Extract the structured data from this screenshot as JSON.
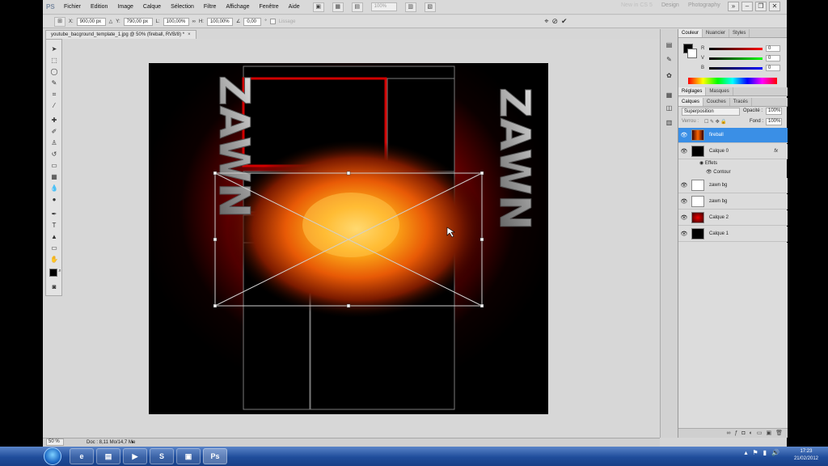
{
  "app": {
    "logo": "PS",
    "menus": [
      "Fichier",
      "Edition",
      "Image",
      "Calque",
      "Sélection",
      "Filtre",
      "Affichage",
      "Fenêtre",
      "Aide"
    ],
    "zoom_display": "100%",
    "workspaces": [
      "New in CS 5",
      "Design",
      "Photography"
    ],
    "overflow": "»"
  },
  "options_bar": {
    "x_label": "X:",
    "x_value": "900,00 px",
    "y_label": "Y:",
    "y_value": "790,00 px",
    "w_label": "L:",
    "w_value": "100,00%",
    "h_label": "H:",
    "h_value": "100,00%",
    "angle_value": "0,00",
    "lissage_label": "Lissage"
  },
  "document": {
    "tab_title": "youtube_bacground_template_1.jpg @ 50% (fireball, RVB/8) *",
    "zoom": "50 %",
    "doc_info": "Doc : 8,11 Mo/14,7 Mo",
    "canvas_text_left": "ZAWN",
    "canvas_text_right": "ZAWN"
  },
  "color_panel": {
    "tabs": [
      "Couleur",
      "Nuancier",
      "Styles"
    ],
    "r_label": "R",
    "r_value": "0",
    "g_label": "V",
    "g_value": "0",
    "b_label": "B",
    "b_value": "0"
  },
  "adjust_tabs": [
    "Réglages",
    "Masques"
  ],
  "layers_panel": {
    "tabs": [
      "Calques",
      "Couches",
      "Tracés"
    ],
    "blend_mode": "Superposition",
    "opacity_label": "Opacité :",
    "opacity_value": "100%",
    "lock_label": "Verrou :",
    "fill_label": "Fond :",
    "fill_value": "100%",
    "layers": [
      {
        "name": "fireball",
        "selected": true
      },
      {
        "name": "Calque 0",
        "selected": false,
        "fx": "fx"
      },
      {
        "name": "zawn bg",
        "selected": false
      },
      {
        "name": "zawn bg",
        "selected": false
      },
      {
        "name": "Calque 2",
        "selected": false
      },
      {
        "name": "Calque 1",
        "selected": false
      }
    ],
    "effects_label": "Effets",
    "contour_label": "Contour"
  },
  "taskbar": {
    "time": "17:23",
    "date": "21/02/2012",
    "ps_label": "Ps"
  }
}
